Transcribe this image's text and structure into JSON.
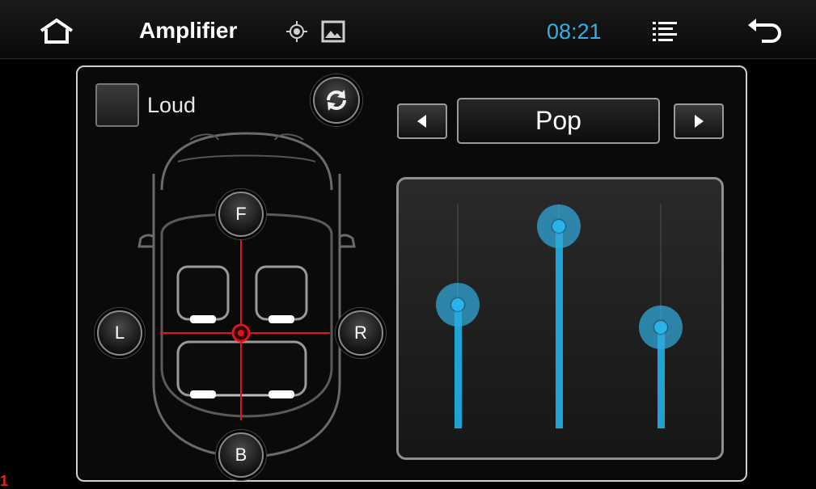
{
  "topbar": {
    "title": "Amplifier",
    "time": "08:21",
    "icons": [
      "home-icon",
      "gps-icon",
      "picture-icon",
      "menu-list-icon",
      "back-icon"
    ]
  },
  "loud": {
    "label": "Loud",
    "checked": false
  },
  "preset": {
    "label": "Pop"
  },
  "balance": {
    "front": "F",
    "back": "B",
    "left": "L",
    "right": "R"
  },
  "equalizer": {
    "bands": [
      {
        "level": 0.55
      },
      {
        "level": 0.9
      },
      {
        "level": 0.45
      }
    ]
  },
  "colors": {
    "accent": "#1fa2d6",
    "clock": "#35aee3",
    "crosshair": "#e0141e"
  },
  "corner_mark": "1"
}
